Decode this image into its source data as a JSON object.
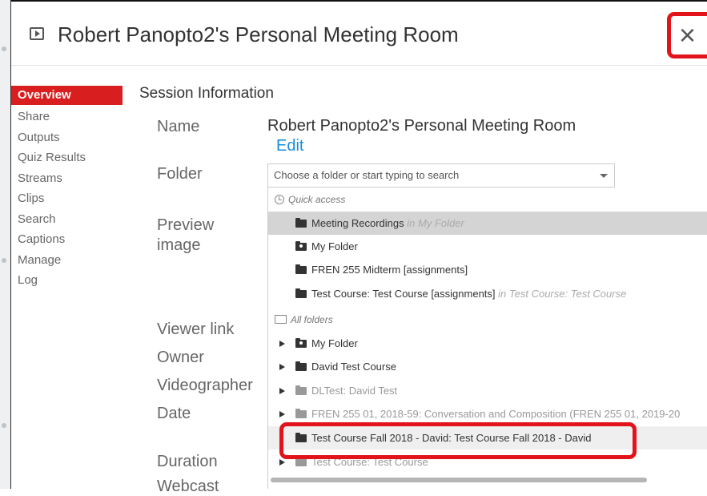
{
  "window": {
    "title": "Robert Panopto2's Personal Meeting Room",
    "close_glyph": "×"
  },
  "sidebar": {
    "items": [
      {
        "label": "Overview",
        "active": true
      },
      {
        "label": "Share"
      },
      {
        "label": "Outputs"
      },
      {
        "label": "Quiz Results"
      },
      {
        "label": "Streams"
      },
      {
        "label": "Clips"
      },
      {
        "label": "Search"
      },
      {
        "label": "Captions"
      },
      {
        "label": "Manage"
      },
      {
        "label": "Log"
      }
    ]
  },
  "main": {
    "section_title": "Session Information",
    "labels": {
      "name": "Name",
      "folder": "Folder",
      "preview_line1": "Preview",
      "preview_line2": "image",
      "viewer_link": "Viewer link",
      "owner": "Owner",
      "videographer": "Videographer",
      "date": "Date",
      "duration": "Duration",
      "webcast": "Webcast"
    },
    "name_value": "Robert Panopto2's Personal Meeting Room",
    "edit_label": "Edit",
    "folder_select": {
      "placeholder": "Choose a folder or start typing to search"
    },
    "dropdown": {
      "quick_access_label": "Quick access",
      "quick_access": [
        {
          "name": "Meeting Recordings",
          "context": "in My Folder",
          "selected": true
        },
        {
          "name": "My Folder",
          "user_folder": true
        },
        {
          "name": "FREN 255 Midterm [assignments]"
        },
        {
          "name": "Test Course: Test Course [assignments]",
          "context": "in Test Course: Test Course"
        }
      ],
      "all_folders_label": "All folders",
      "all_folders": [
        {
          "name": "My Folder",
          "user_folder": true
        },
        {
          "name": "David Test Course"
        },
        {
          "name": "DLTest: David Test",
          "dim": true
        },
        {
          "name": "FREN 255 01, 2018-59: Conversation and Composition (FREN 255 01, 2019-20",
          "dim": true
        },
        {
          "name": "Test Course Fall 2018 - David: Test Course Fall 2018 - David",
          "highlighted": true
        },
        {
          "name": "Test Course: Test Course",
          "dim": true
        }
      ]
    }
  },
  "colors": {
    "accent_red": "#d81e1e",
    "callout_red": "#e3131b",
    "link_blue": "#1a8cd8"
  }
}
